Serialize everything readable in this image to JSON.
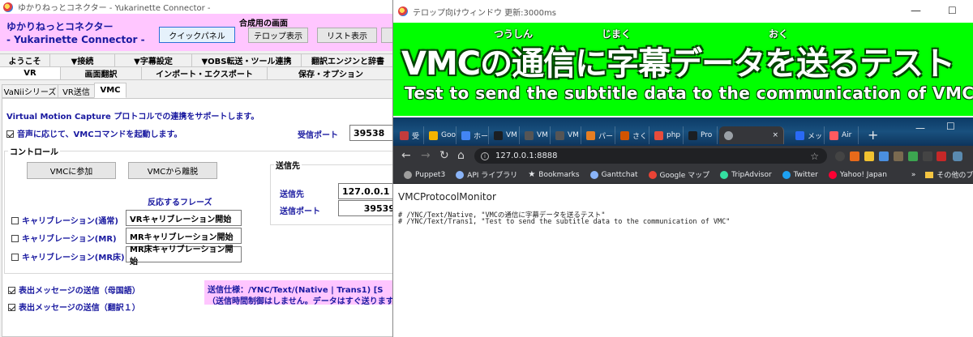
{
  "left_window": {
    "title": "ゆかりねっとコネクター - Yukarinette Connector -",
    "brand_line1": "ゆかりねっとコネクター",
    "brand_line2": " - Yukarinette Connector -",
    "composite_label": "合成用の画面",
    "quick_panel_button": "クイックパネル",
    "telop_button": "テロップ表示",
    "list_button": "リスト表示",
    "tabs_row1": [
      "ようこそ",
      "▼接続",
      "▼字幕設定",
      "▼OBS転送・ツール連携",
      "翻訳エンジンと辞書"
    ],
    "tabs_row2": [
      "VR",
      "画面翻訳",
      "インポート・エクスポート",
      "保存・オプション"
    ],
    "tabs_row3": [
      "VaNiiシリーズ",
      "VR送信",
      "VMC"
    ],
    "support_text": "Virtual Motion Capture プロトコルでの連携をサポートします。",
    "voice_start_label": "音声に応じて、VMCコマンドを起動します。",
    "receive_port_label": "受信ポート",
    "receive_port_value": "39538",
    "control_label": "コントロール",
    "join_button": "VMCに参加",
    "leave_button": "VMCから離脱",
    "phrase_header": "反応するフレーズ",
    "calibrations": [
      {
        "label": "キャリブレーション(通常)",
        "phrase": "VRキャリブレーション開始"
      },
      {
        "label": "キャリブレーション(MR)",
        "phrase": "MRキャリブレーション開始"
      },
      {
        "label": "キャリブレーション(MR床)",
        "phrase": "MR床キャリブレーション開始"
      }
    ],
    "destination_group": "送信先",
    "destination_label": "送信先",
    "destination_value": "127.0.0.1",
    "send_port_label": "送信ポート",
    "send_port_value": "39539",
    "send_native_label": "表出メッセージの送信（母国語）",
    "send_trans_label": "表出メッセージの送信（翻訳１）",
    "spec_line1": "送信仕様：/YNC/Text/(Native | Trans1) [S",
    "spec_line2": "（送信時間制御はしません。データはすぐ送ります）"
  },
  "telop_window": {
    "title": "テロップ向けウィンドウ 更新:3000ms",
    "ruby": "つうしん　　　じまく　　　　　　　　おく",
    "jp_text": "VMCの通信に字幕データを送るテスト",
    "en_text": "Test to send the subtitle data to the communication of VMC"
  },
  "browser": {
    "tabs": [
      "受",
      "Goo",
      "ホー",
      "VM",
      "VM",
      "VM",
      "パー",
      "さく",
      "php",
      "Pro",
      "",
      "メッ",
      "Air"
    ],
    "url": "127.0.0.1:8888",
    "bookmarks": [
      "Puppet3",
      "API ライブラリ",
      "Bookmarks",
      "Ganttchat",
      "Google マップ",
      "TripAdvisor",
      "Twitter",
      "Yahoo! Japan"
    ],
    "more_bookmarks": "»",
    "other_bookmarks": "その他のブックマーク",
    "monitor_title": "VMCProtocolMonitor",
    "log_lines": [
      "# /YNC/Text/Native, \"VMCの通信に字幕データを送るテスト\"",
      "# /YNC/Text/Trans1, \"Test to send the subtitle data to the communication of VMC\""
    ]
  },
  "colors": {
    "header_pink": "#ffc6ff",
    "label_blue": "#1a1aa0",
    "chroma_green": "#00ff00"
  }
}
